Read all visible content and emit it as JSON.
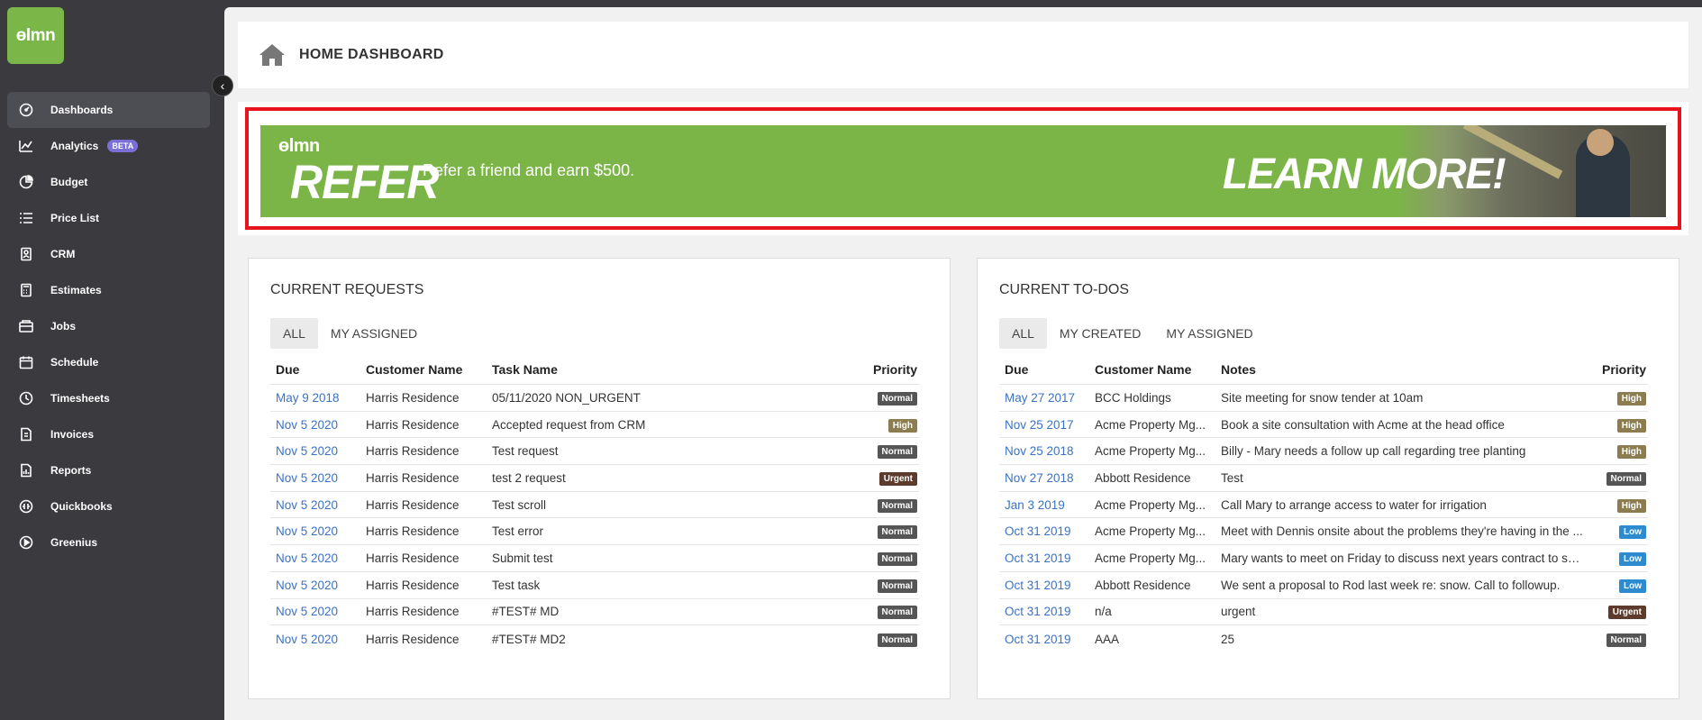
{
  "app": {
    "logo_text": "ɵlmn"
  },
  "sidebar": {
    "items": [
      {
        "label": "Dashboards",
        "icon": "dashboard-icon",
        "active": true
      },
      {
        "label": "Analytics",
        "icon": "analytics-icon",
        "badge": "BETA"
      },
      {
        "label": "Budget",
        "icon": "pie-chart-icon"
      },
      {
        "label": "Price List",
        "icon": "list-icon"
      },
      {
        "label": "CRM",
        "icon": "contact-card-icon"
      },
      {
        "label": "Estimates",
        "icon": "calculator-icon"
      },
      {
        "label": "Jobs",
        "icon": "jobs-icon"
      },
      {
        "label": "Schedule",
        "icon": "calendar-icon"
      },
      {
        "label": "Timesheets",
        "icon": "clock-icon"
      },
      {
        "label": "Invoices",
        "icon": "invoice-icon"
      },
      {
        "label": "Reports",
        "icon": "report-icon"
      },
      {
        "label": "Quickbooks",
        "icon": "quickbooks-icon"
      },
      {
        "label": "Greenius",
        "icon": "play-icon"
      }
    ]
  },
  "header": {
    "title": "HOME DASHBOARD"
  },
  "banner": {
    "logo": "ɵlmn",
    "title": "REFER",
    "text": "Refer a friend and earn $500.",
    "cta": "LEARN MORE!"
  },
  "requests": {
    "title": "CURRENT REQUESTS",
    "tabs": [
      "ALL",
      "MY ASSIGNED"
    ],
    "columns": [
      "Due",
      "Customer Name",
      "Task Name",
      "Priority"
    ],
    "rows": [
      [
        "May 9 2018",
        "Harris Residence",
        "05/11/2020 NON_URGENT",
        "Normal"
      ],
      [
        "Nov 5 2020",
        "Harris Residence",
        "Accepted request from CRM",
        "High"
      ],
      [
        "Nov 5 2020",
        "Harris Residence",
        "Test request",
        "Normal"
      ],
      [
        "Nov 5 2020",
        "Harris Residence",
        "test 2 request",
        "Urgent"
      ],
      [
        "Nov 5 2020",
        "Harris Residence",
        "Test scroll",
        "Normal"
      ],
      [
        "Nov 5 2020",
        "Harris Residence",
        "Test error",
        "Normal"
      ],
      [
        "Nov 5 2020",
        "Harris Residence",
        "Submit test",
        "Normal"
      ],
      [
        "Nov 5 2020",
        "Harris Residence",
        "Test task",
        "Normal"
      ],
      [
        "Nov 5 2020",
        "Harris Residence",
        "#TEST# MD",
        "Normal"
      ],
      [
        "Nov 5 2020",
        "Harris Residence",
        "#TEST# MD2",
        "Normal"
      ]
    ]
  },
  "todos": {
    "title": "CURRENT TO-DOS",
    "tabs": [
      "ALL",
      "MY CREATED",
      "MY ASSIGNED"
    ],
    "columns": [
      "Due",
      "Customer Name",
      "Notes",
      "Priority"
    ],
    "rows": [
      [
        "May 27 2017",
        "BCC Holdings",
        "Site meeting for snow tender at 10am",
        "High"
      ],
      [
        "Nov 25 2017",
        "Acme Property Mg...",
        "Book a site consultation with Acme at the head office",
        "High"
      ],
      [
        "Nov 25 2018",
        "Acme Property Mg...",
        "Billy - Mary needs a follow up call regarding tree planting",
        "High"
      ],
      [
        "Nov 27 2018",
        "Abbott Residence",
        "Test",
        "Normal"
      ],
      [
        "Jan 3 2019",
        "Acme Property Mg...",
        "Call Mary to arrange access to water for irrigation",
        "High"
      ],
      [
        "Oct 31 2019",
        "Acme Property Mg...",
        "Meet with Dennis onsite about the problems they're having in the ...",
        "Low"
      ],
      [
        "Oct 31 2019",
        "Acme Property Mg...",
        "Mary wants to meet on Friday to discuss next years contract to see...",
        "Low"
      ],
      [
        "Oct 31 2019",
        "Abbott Residence",
        "We sent a proposal to Rod last week re: snow. Call to followup.",
        "Low"
      ],
      [
        "Oct 31 2019",
        "n/a",
        "urgent",
        "Urgent"
      ],
      [
        "Oct 31 2019",
        "AAA",
        "25",
        "Normal"
      ]
    ]
  }
}
